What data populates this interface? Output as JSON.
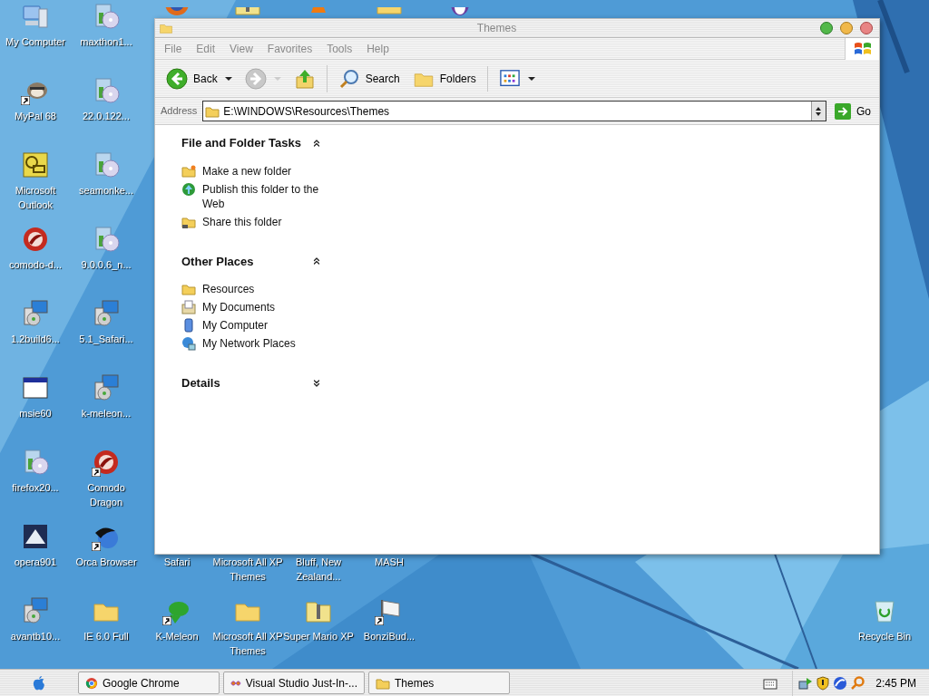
{
  "desktop": {
    "icons": [
      {
        "label": "My Computer",
        "kind": "computer",
        "shortcut": false
      },
      {
        "label": "maxthon1...",
        "kind": "installer",
        "shortcut": false
      },
      {
        "label": "MyPal 68",
        "kind": "raccoon",
        "shortcut": true
      },
      {
        "label": "22.0.122...",
        "kind": "installer",
        "shortcut": false
      },
      {
        "label": "Microsoft Outlook",
        "kind": "outlook",
        "shortcut": false
      },
      {
        "label": "seamonke...",
        "kind": "installer",
        "shortcut": false
      },
      {
        "label": "comodo-d...",
        "kind": "dragon",
        "shortcut": false
      },
      {
        "label": "9.0.0.6_n...",
        "kind": "installer",
        "shortcut": false
      },
      {
        "label": "1.2build6...",
        "kind": "setup",
        "shortcut": false
      },
      {
        "label": "5.1_Safari...",
        "kind": "setup",
        "shortcut": false
      },
      {
        "label": "msie60",
        "kind": "window",
        "shortcut": false
      },
      {
        "label": "k-meleon...",
        "kind": "setup",
        "shortcut": false
      },
      {
        "label": "firefox20...",
        "kind": "installer",
        "shortcut": false
      },
      {
        "label": "Comodo Dragon",
        "kind": "dragon",
        "shortcut": true
      },
      {
        "label": "opera901",
        "kind": "opera",
        "shortcut": false
      },
      {
        "label": "Orca Browser",
        "kind": "orca",
        "shortcut": true
      },
      {
        "label": "avantb10...",
        "kind": "setup",
        "shortcut": false
      },
      {
        "label": "IE 6.0 Full",
        "kind": "folder",
        "shortcut": false
      },
      {
        "label": "Safari",
        "kind": "hidden"
      },
      {
        "label": "Microsoft All XP Themes",
        "kind": "hidden"
      },
      {
        "label": "Bluff, New Zealand...",
        "kind": "hidden"
      },
      {
        "label": "MASH",
        "kind": "hidden"
      },
      {
        "label": "K-Meleon",
        "kind": "lizard",
        "shortcut": true
      },
      {
        "label": "Microsoft All XP Themes",
        "kind": "folder",
        "shortcut": false
      },
      {
        "label": "Super Mario XP",
        "kind": "zip",
        "shortcut": false
      },
      {
        "label": "BonziBud...",
        "kind": "flag",
        "shortcut": true
      },
      {
        "label": "Recycle Bin",
        "kind": "recycle",
        "shortcut": false
      },
      {
        "kind": "globe"
      },
      {
        "kind": "zip"
      },
      {
        "kind": "cone"
      },
      {
        "kind": "folder"
      },
      {
        "kind": "penguin"
      }
    ]
  },
  "window": {
    "title": "Themes",
    "menu": [
      "File",
      "Edit",
      "View",
      "Favorites",
      "Tools",
      "Help"
    ],
    "toolbar": [
      {
        "kind": "back",
        "label": "Back",
        "disabled": false
      },
      {
        "kind": "forward",
        "disabled": true
      },
      {
        "kind": "up"
      },
      {
        "kind": "search",
        "label": "Search"
      },
      {
        "kind": "folders",
        "label": "Folders"
      },
      {
        "kind": "views"
      }
    ],
    "address": {
      "label": "Address",
      "value": "E:\\WINDOWS\\Resources\\Themes",
      "go": "Go"
    },
    "task_pane": [
      {
        "title": "File and Folder Tasks",
        "expanded": true,
        "items": [
          {
            "label": "Make a new folder",
            "kind": "newfolder"
          },
          {
            "label": "Publish this folder to the Web",
            "kind": "globe"
          },
          {
            "label": "Share this folder",
            "kind": "share"
          }
        ]
      },
      {
        "title": "Other Places",
        "expanded": true,
        "items": [
          {
            "label": "Resources",
            "kind": "folder"
          },
          {
            "label": "My Documents",
            "kind": "documents"
          },
          {
            "label": "My Computer",
            "kind": "computer"
          },
          {
            "label": "My Network Places",
            "kind": "network"
          }
        ]
      },
      {
        "title": "Details",
        "expanded": false
      }
    ]
  },
  "taskbar": {
    "tasks": [
      {
        "label": "Google Chrome",
        "kind": "chrome"
      },
      {
        "label": "Visual Studio Just-In-...",
        "kind": "vs"
      },
      {
        "label": "Themes",
        "kind": "folder"
      }
    ],
    "clock": "2:45 PM"
  }
}
